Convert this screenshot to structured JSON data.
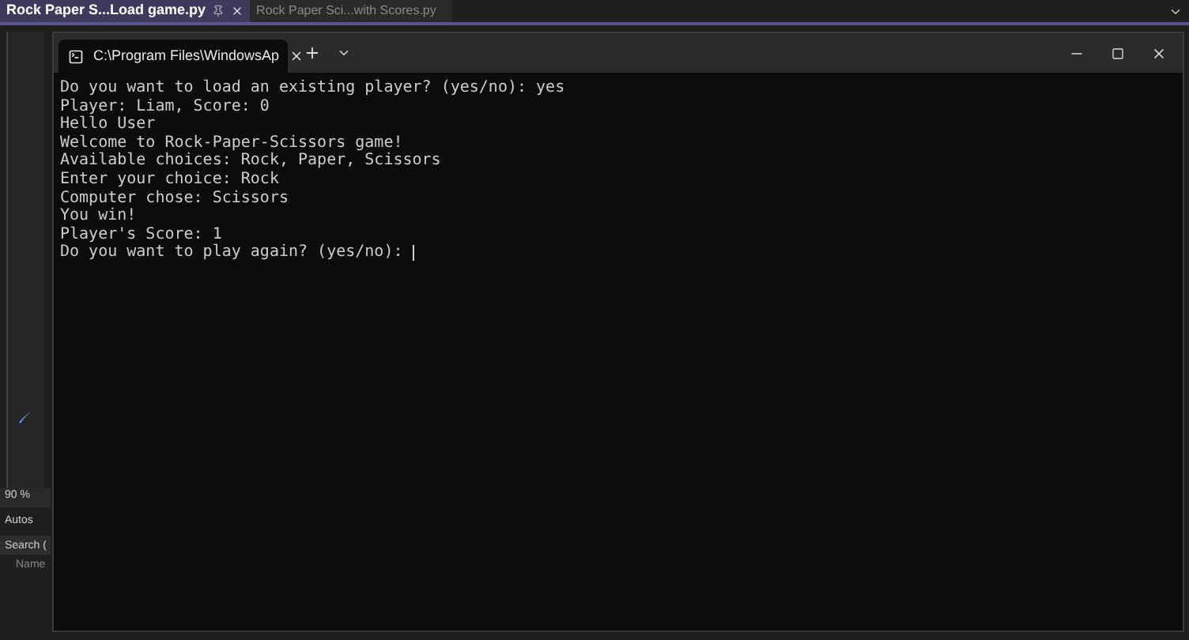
{
  "editor_tabs": [
    {
      "label": "Rock Paper S...Load game.py",
      "selected": true
    },
    {
      "label": "Rock Paper Sci...with Scores.py",
      "selected": false
    }
  ],
  "side_panel": {
    "zoom": "90 %",
    "panel_title": "Autos",
    "search_placeholder": "Search (",
    "column": "Name"
  },
  "terminal": {
    "tab_title": "C:\\Program Files\\WindowsAp",
    "lines": [
      "Do you want to load an existing player? (yes/no): yes",
      "Player: Liam, Score: 0",
      "Hello User",
      "Welcome to Rock-Paper-Scissors game!",
      "Available choices: Rock, Paper, Scissors",
      "Enter your choice: Rock",
      "Computer chose: Scissors",
      "You win!",
      "Player's Score: 1",
      "Do you want to play again? (yes/no): "
    ]
  }
}
